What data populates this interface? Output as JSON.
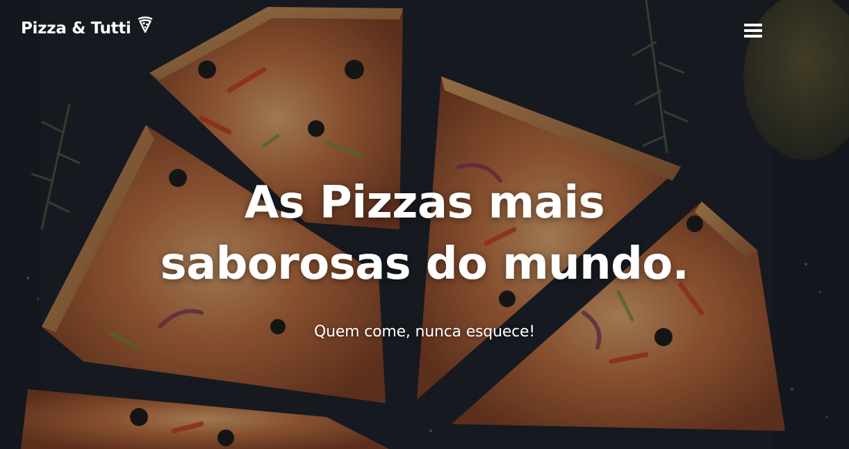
{
  "navbar": {
    "brand_label": "Pizza & Tutti",
    "brand_icon": "pizza-slice-icon",
    "menu_icon": "hamburger-menu-icon"
  },
  "hero": {
    "title": "As Pizzas mais saborosas do mundo.",
    "subtitle": "Quem come, nunca esquece!",
    "background_image": "pizza slices on dark board",
    "text_color": "#ffffff"
  }
}
